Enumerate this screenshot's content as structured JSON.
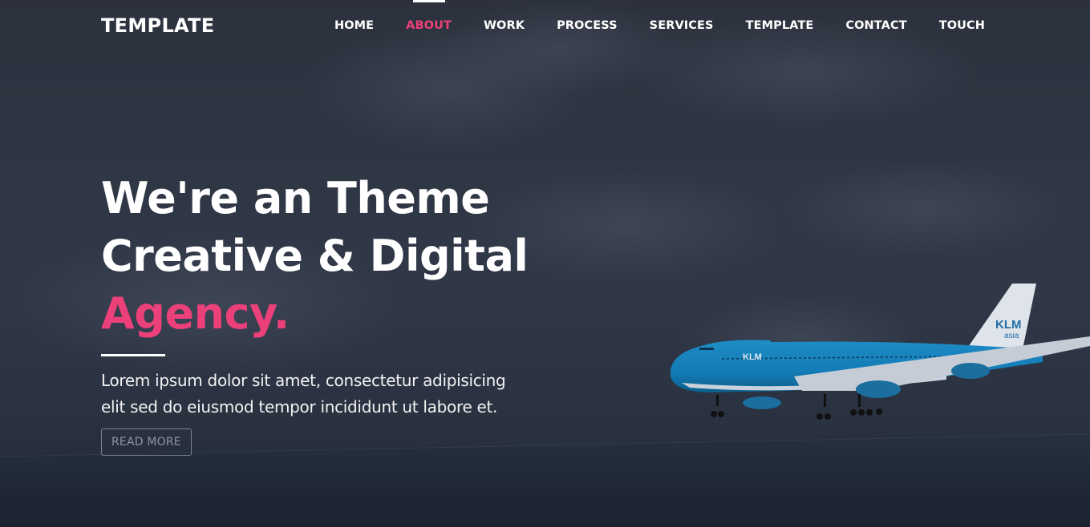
{
  "nav": {
    "brand": "TEMPLATE",
    "items": [
      {
        "label": "HOME",
        "active": false
      },
      {
        "label": "ABOUT",
        "active": true
      },
      {
        "label": "WORK",
        "active": false
      },
      {
        "label": "PROCESS",
        "active": false
      },
      {
        "label": "SERVICES",
        "active": false
      },
      {
        "label": "TEMPLATE",
        "active": false
      },
      {
        "label": "CONTACT",
        "active": false
      },
      {
        "label": "TOUCH",
        "active": false
      }
    ]
  },
  "hero": {
    "line1": "We're an Theme",
    "line2": "Creative & Digital",
    "accent": "Agency.",
    "description_line1": "Lorem ipsum dolor sit amet, consectetur adipisicing",
    "description_line2": "elit sed do eiusmod tempor incididunt ut labore et.",
    "button_label": "READ MORE",
    "airplane_livery": "KLM",
    "airplane_livery_sub": "asia"
  },
  "colors": {
    "accent": "#ec407a",
    "text": "#ffffff",
    "overlay": "#2f3644"
  }
}
